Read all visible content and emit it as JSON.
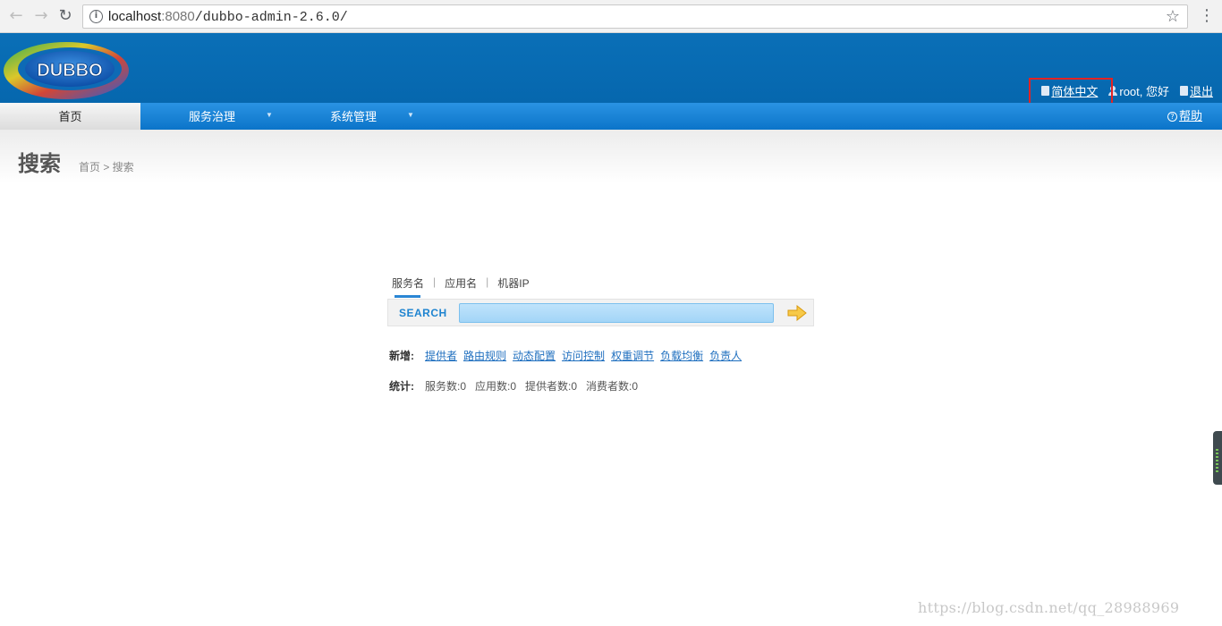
{
  "browser": {
    "back_icon": "back-arrow-icon",
    "forward_icon": "forward-arrow-icon",
    "reload_icon": "reload-icon",
    "url_host": "localhost",
    "url_port": ":8080",
    "url_path": "/dubbo-admin-2.6.0/"
  },
  "header": {
    "logo_text": "DUBBO",
    "language_link": "简体中文",
    "user_greeting": "root, 您好",
    "logout_link": "退出"
  },
  "menu": {
    "home": "首页",
    "service_governance": "服务治理",
    "system_management": "系统管理",
    "help": "帮助"
  },
  "page": {
    "title": "搜索",
    "breadcrumb": "首页 > 搜索"
  },
  "search": {
    "tabs": [
      "服务名",
      "应用名",
      "机器IP"
    ],
    "label": "SEARCH",
    "input_value": ""
  },
  "add_row": {
    "label": "新增:",
    "links": [
      "提供者",
      "路由规则",
      "动态配置",
      "访问控制",
      "权重调节",
      "负载均衡",
      "负责人"
    ]
  },
  "stats_row": {
    "label": "统计:",
    "items": [
      "服务数:0",
      "应用数:0",
      "提供者数:0",
      "消费者数:0"
    ]
  },
  "watermark": "https://blog.csdn.net/qq_28988969",
  "colors": {
    "header_blue": "#0667ae",
    "menu_blue": "#0b74c9",
    "highlight_red": "#e32323",
    "link_blue": "#1f6fbf"
  }
}
